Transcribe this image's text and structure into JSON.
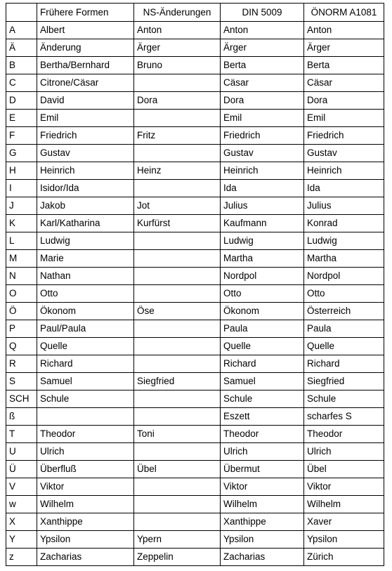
{
  "table": {
    "headers": [
      {
        "key": "letter",
        "label": "",
        "align": "left"
      },
      {
        "key": "old",
        "label": "Frühere Formen",
        "align": "left"
      },
      {
        "key": "ns",
        "label": "NS-Änderungen",
        "align": "center"
      },
      {
        "key": "din",
        "label": "DIN 5009",
        "align": "center"
      },
      {
        "key": "onorm",
        "label": "ÖNORM A1081",
        "align": "center"
      }
    ],
    "rows": [
      {
        "letter": "A",
        "old": "Albert",
        "ns": "Anton",
        "din": "Anton",
        "onorm": "Anton"
      },
      {
        "letter": "Ä",
        "old": "Änderung",
        "ns": "Ärger",
        "din": "Ärger",
        "onorm": "Ärger"
      },
      {
        "letter": "B",
        "old": "Bertha/Bernhard",
        "ns": "Bruno",
        "din": "Berta",
        "onorm": "Berta"
      },
      {
        "letter": "C",
        "old": "Citrone/Cäsar",
        "ns": "",
        "din": "Cäsar",
        "onorm": "Cäsar"
      },
      {
        "letter": "D",
        "old": "David",
        "ns": "Dora",
        "din": "Dora",
        "onorm": "Dora"
      },
      {
        "letter": "E",
        "old": "Emil",
        "ns": "",
        "din": "Emil",
        "onorm": "Emil"
      },
      {
        "letter": "F",
        "old": "Friedrich",
        "ns": "Fritz",
        "din": "Friedrich",
        "onorm": "Friedrich"
      },
      {
        "letter": "G",
        "old": "Gustav",
        "ns": "",
        "din": "Gustav",
        "onorm": "Gustav"
      },
      {
        "letter": "H",
        "old": "Heinrich",
        "ns": "Heinz",
        "din": "Heinrich",
        "onorm": "Heinrich"
      },
      {
        "letter": "I",
        "old": "Isidor/Ida",
        "ns": "",
        "din": "Ida",
        "onorm": "Ida"
      },
      {
        "letter": "J",
        "old": "Jakob",
        "ns": "Jot",
        "din": "Julius",
        "onorm": "Julius"
      },
      {
        "letter": "K",
        "old": "Karl/Katharina",
        "ns": "Kurfürst",
        "din": "Kaufmann",
        "onorm": "Konrad"
      },
      {
        "letter": "L",
        "old": "Ludwig",
        "ns": "",
        "din": "Ludwig",
        "onorm": "Ludwig"
      },
      {
        "letter": "M",
        "old": "Marie",
        "ns": "",
        "din": "Martha",
        "onorm": "Martha"
      },
      {
        "letter": "N",
        "old": "Nathan",
        "ns": "",
        "din": "Nordpol",
        "onorm": "Nordpol"
      },
      {
        "letter": "O",
        "old": "Otto",
        "ns": "",
        "din": "Otto",
        "onorm": "Otto"
      },
      {
        "letter": "Ö",
        "old": "Ökonom",
        "ns": "Öse",
        "din": "Ökonom",
        "onorm": "Österreich"
      },
      {
        "letter": "P",
        "old": "Paul/Paula",
        "ns": "",
        "din": "Paula",
        "onorm": "Paula"
      },
      {
        "letter": "Q",
        "old": "Quelle",
        "ns": "",
        "din": "Quelle",
        "onorm": "Quelle"
      },
      {
        "letter": "R",
        "old": "Richard",
        "ns": "",
        "din": "Richard",
        "onorm": "Richard"
      },
      {
        "letter": "S",
        "old": "Samuel",
        "ns": "Siegfried",
        "din": "Samuel",
        "onorm": "Siegfried"
      },
      {
        "letter": "SCH",
        "old": "Schule",
        "ns": "",
        "din": "Schule",
        "onorm": "Schule"
      },
      {
        "letter": "ß",
        "old": "",
        "ns": "",
        "din": "Eszett",
        "onorm": "scharfes S"
      },
      {
        "letter": "T",
        "old": "Theodor",
        "ns": "Toni",
        "din": "Theodor",
        "onorm": "Theodor"
      },
      {
        "letter": "U",
        "old": "Ulrich",
        "ns": "",
        "din": "Ulrich",
        "onorm": "Ulrich"
      },
      {
        "letter": "Ü",
        "old": "Überfluß",
        "ns": "Übel",
        "din": "Übermut",
        "onorm": "Übel"
      },
      {
        "letter": "V",
        "old": "Viktor",
        "ns": "",
        "din": "Viktor",
        "onorm": "Viktor"
      },
      {
        "letter": "w",
        "old": "Wilhelm",
        "ns": "",
        "din": "Wilhelm",
        "onorm": "Wilhelm"
      },
      {
        "letter": "X",
        "old": "Xanthippe",
        "ns": "",
        "din": "Xanthippe",
        "onorm": "Xaver"
      },
      {
        "letter": "Y",
        "old": "Ypsilon",
        "ns": "Ypern",
        "din": "Ypsilon",
        "onorm": "Ypsilon"
      },
      {
        "letter": "z",
        "old": "Zacharias",
        "ns": "Zeppelin",
        "din": "Zacharias",
        "onorm": "Zürich"
      }
    ]
  }
}
